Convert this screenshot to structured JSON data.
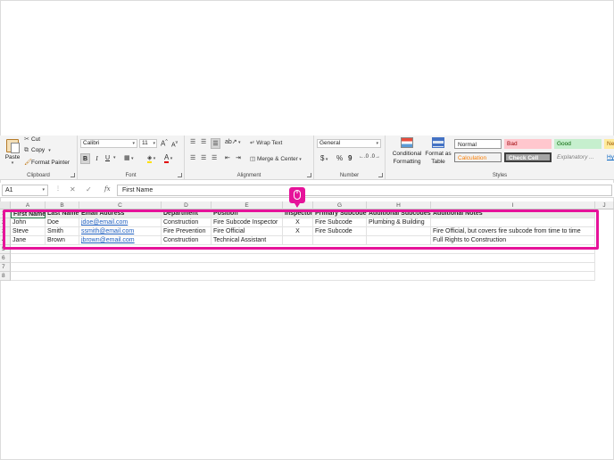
{
  "ribbon": {
    "clipboard": {
      "group_label": "Clipboard",
      "paste_label": "Paste",
      "cut_label": "Cut",
      "copy_label": "Copy",
      "format_painter_label": "Format Painter"
    },
    "font": {
      "group_label": "Font",
      "font_name": "Calibri",
      "font_size": "11",
      "grow_label": "A",
      "shrink_label": "A",
      "bold_label": "B",
      "italic_label": "I",
      "underline_label": "U",
      "font_color_label": "A"
    },
    "alignment": {
      "group_label": "Alignment",
      "wrap_text_label": "Wrap Text",
      "merge_center_label": "Merge & Center"
    },
    "number": {
      "group_label": "Number",
      "format_value": "General",
      "currency_label": "$",
      "percent_label": "%",
      "comma_label": "9"
    },
    "styles": {
      "group_label": "Styles",
      "conditional_formatting_label": "Conditional Formatting",
      "format_as_table_label": "Format as Table",
      "normal_label": "Normal",
      "bad_label": "Bad",
      "good_label": "Good",
      "neutral_label": "Ne",
      "calculation_label": "Calculation",
      "check_cell_label": "Check Cell",
      "explanatory_label": "Explanatory ...",
      "hyperlink_label": "Hy"
    }
  },
  "formula_bar": {
    "name_box": "A1",
    "cancel_symbol": "✕",
    "enter_symbol": "✓",
    "fx_label": "fx",
    "content": "First Name"
  },
  "columns": [
    "A",
    "B",
    "C",
    "D",
    "E",
    "F",
    "G",
    "H",
    "I",
    "J"
  ],
  "rows": [
    "1",
    "2",
    "3",
    "4",
    "5",
    "6",
    "7",
    "8"
  ],
  "table": {
    "headers": [
      "First Name",
      "Last Name",
      "Email Address",
      "Department",
      "Position",
      "Inspector",
      "Primary Subcode",
      "Additional Subcodes",
      "Additional Notes"
    ],
    "data": [
      [
        "John",
        "Doe",
        "jdoe@email.com",
        "Construction",
        "Fire Subcode Inspector",
        "X",
        "Fire Subcode",
        "Plumbing & Building",
        ""
      ],
      [
        "Steve",
        "Smith",
        "ssmith@email.com",
        "Fire Prevention",
        "Fire Official",
        "X",
        "Fire Subcode",
        "",
        "Fire Official, but covers fire subcode from time to time"
      ],
      [
        "Jane",
        "Brown",
        "jbrown@email.com",
        "Construction",
        "Technical Assistant",
        "",
        "",
        "",
        "Full Rights to Construction"
      ]
    ]
  },
  "colors": {
    "highlight": "#e6139a",
    "bad_fill": "#ffc7ce",
    "good_fill": "#c6efce",
    "neutral_fill": "#ffeb9c",
    "check_cell_fill": "#a5a5a5"
  }
}
